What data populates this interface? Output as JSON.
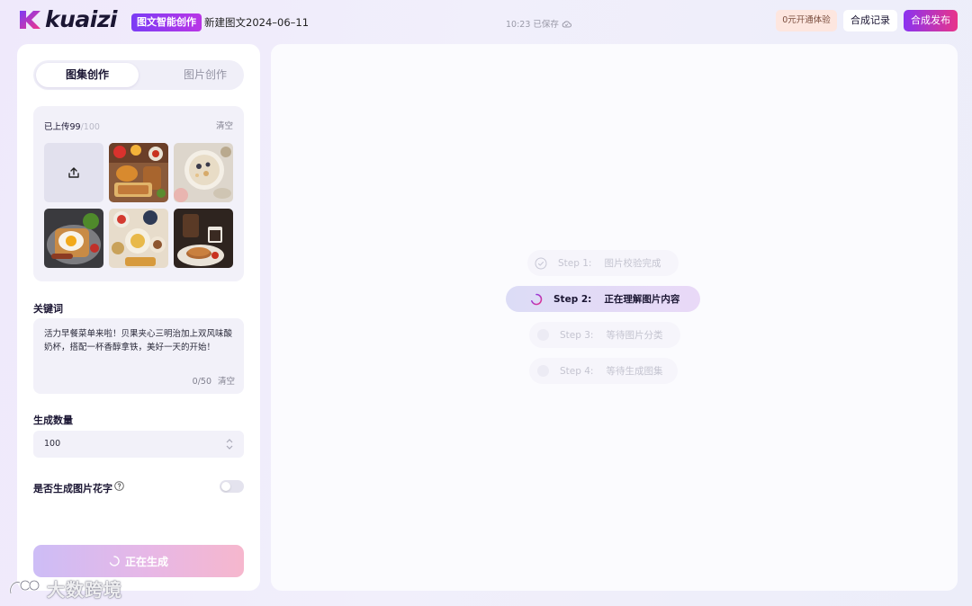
{
  "header": {
    "logo_text": "kuaizi",
    "brand_tag": "图文智能创作",
    "doc_title": "新建图文2024–06–11",
    "save_status": "10:23 已保存",
    "trial_label": "0元开通体验",
    "history_label": "合成记录",
    "publish_label": "合成发布"
  },
  "left_panel": {
    "tabs": [
      {
        "label": "图集创作",
        "active": true
      },
      {
        "label": "图片创作",
        "active": false
      }
    ],
    "upload": {
      "uploaded_label": "已上传99",
      "max_label": "/100",
      "clear_label": "清空",
      "upload_icon": "upload-icon",
      "images": [
        "breakfast-toast-fruit-photo",
        "porridge-bowl-photo",
        "fried-egg-toast-photo",
        "breakfast-spread-photo",
        "coffee-pancakes-photo"
      ]
    },
    "keywords": {
      "label": "关键词",
      "text": "活力早餐菜单来啦！贝果夹心三明治加上双风味酸奶杯，搭配一杯香醇拿铁，美好一天的开始！",
      "count": "0/50",
      "clear_label": "清空"
    },
    "quantity": {
      "label": "生成数量",
      "value": "100"
    },
    "font_toggle": {
      "label": "是否生成图片花字",
      "enabled": false
    },
    "generate_label": "正在生成"
  },
  "steps": [
    {
      "num": "Step 1:",
      "text": "图片校验完成",
      "state": "done"
    },
    {
      "num": "Step 2:",
      "text": "正在理解图片内容",
      "state": "active"
    },
    {
      "num": "Step 3:",
      "text": "等待图片分类",
      "state": "pending"
    },
    {
      "num": "Step 4:",
      "text": "等待生成图集",
      "state": "pending"
    }
  ],
  "watermark": "大数跨境",
  "colors": {
    "accent_purple": "#7b3cf5",
    "accent_pink": "#e8348a",
    "trial_bg": "#fde6df"
  }
}
